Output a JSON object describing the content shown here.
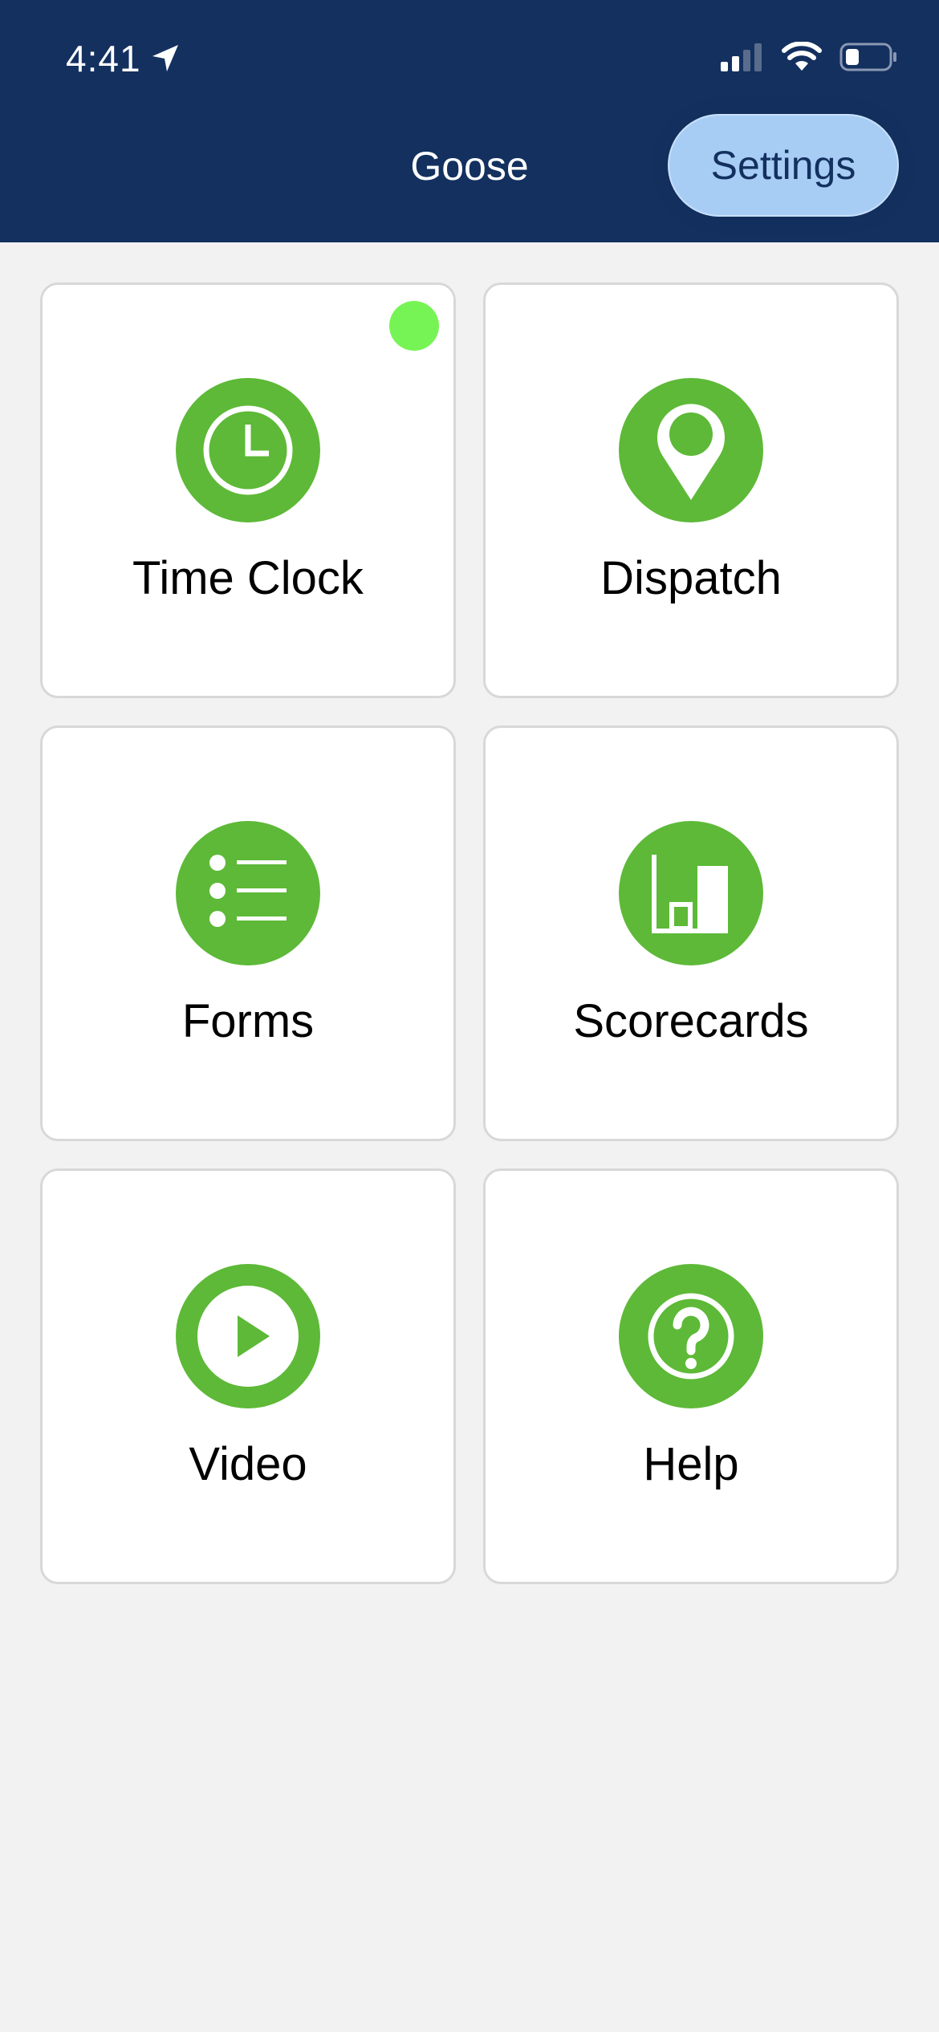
{
  "status_bar": {
    "time": "4:41",
    "location_icon": "location-arrow-icon",
    "signal_icon": "cellular-signal-icon",
    "wifi_icon": "wifi-icon",
    "battery_icon": "battery-icon"
  },
  "header": {
    "title": "Goose",
    "settings_label": "Settings",
    "background_color": "#13305f",
    "settings_color": "#a8cdf5"
  },
  "tiles": [
    {
      "label": "Time Clock",
      "icon": "clock-icon",
      "has_status_dot": true,
      "status_dot_color": "#77f455"
    },
    {
      "label": "Dispatch",
      "icon": "map-pin-icon",
      "has_status_dot": false
    },
    {
      "label": "Forms",
      "icon": "list-icon",
      "has_status_dot": false
    },
    {
      "label": "Scorecards",
      "icon": "bar-chart-icon",
      "has_status_dot": false
    },
    {
      "label": "Video",
      "icon": "play-icon",
      "has_status_dot": false
    },
    {
      "label": "Help",
      "icon": "question-icon",
      "has_status_dot": false
    }
  ],
  "accent_color": "#5db937"
}
